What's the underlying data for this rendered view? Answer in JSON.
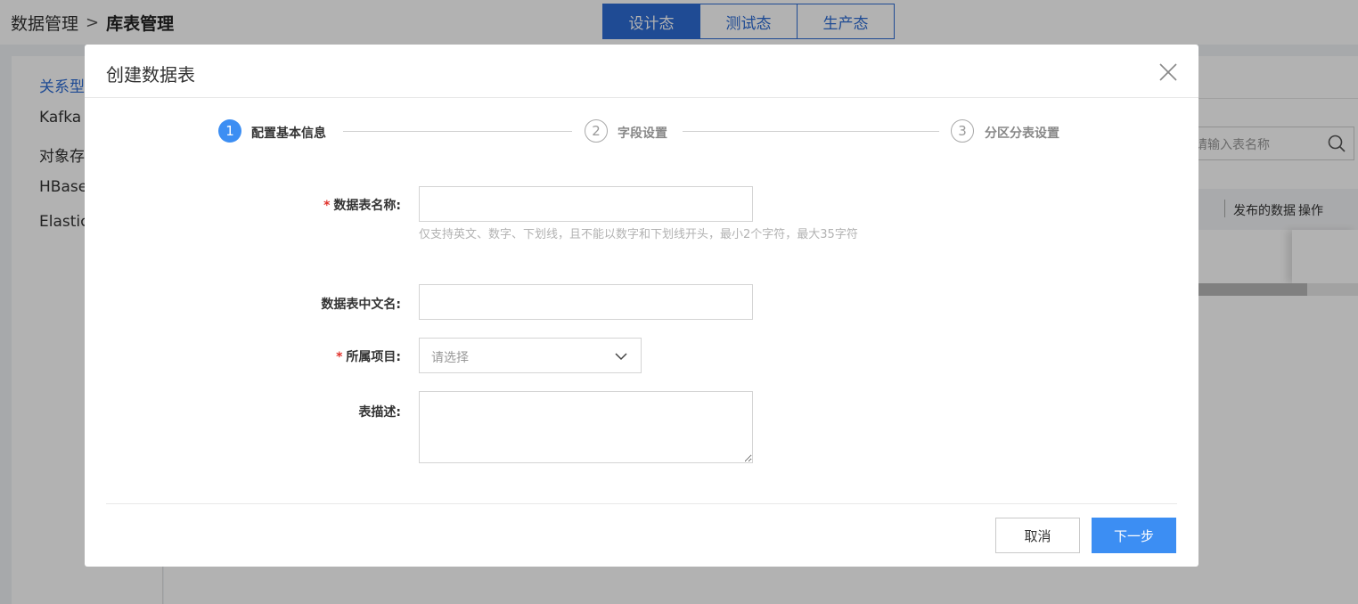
{
  "breadcrumb": {
    "parent": "数据管理",
    "separator": ">",
    "current": "库表管理"
  },
  "env_tabs": [
    {
      "label": "设计态",
      "active": true
    },
    {
      "label": "测试态",
      "active": false
    },
    {
      "label": "生产态",
      "active": false
    }
  ],
  "sidebar": {
    "items": [
      {
        "label": "关系型",
        "active": true
      },
      {
        "label": "Kafka",
        "active": false
      },
      {
        "label": "对象存",
        "active": false
      },
      {
        "label": "HBase",
        "active": false
      },
      {
        "label": "Elastic",
        "active": false
      }
    ]
  },
  "background": {
    "search_placeholder": "请输入表名称",
    "table_headers": [
      "发布的数据",
      "操作"
    ]
  },
  "modal": {
    "title": "创建数据表",
    "steps": [
      {
        "number": "1",
        "label": "配置基本信息",
        "active": true
      },
      {
        "number": "2",
        "label": "字段设置",
        "active": false
      },
      {
        "number": "3",
        "label": "分区分表设置",
        "active": false
      }
    ],
    "form": {
      "required_mark": "*",
      "table_name_label": "数据表名称:",
      "table_name_value": "",
      "table_name_hint": "仅支持英文、数字、下划线，且不能以数字和下划线开头，最小2个字符，最大35字符",
      "cn_name_label": "数据表中文名:",
      "cn_name_value": "",
      "project_label": "所属项目:",
      "project_placeholder": "请选择",
      "desc_label": "表描述:",
      "desc_value": ""
    },
    "buttons": {
      "cancel": "取消",
      "next": "下一步"
    }
  },
  "colors": {
    "primary": "#3c8ef3",
    "tab_blue": "#2d6cd4",
    "required": "#e0312b"
  }
}
